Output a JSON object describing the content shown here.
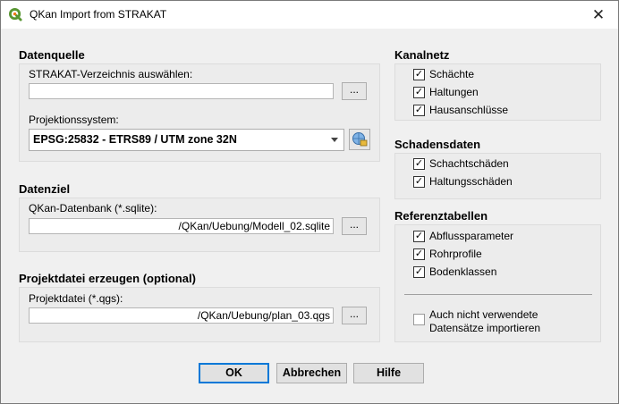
{
  "window": {
    "title": "QKan Import from STRAKAT",
    "close_glyph": "✕"
  },
  "datenquelle": {
    "heading": "Datenquelle",
    "dir_label": "STRAKAT-Verzeichnis auswählen:",
    "dir_value": "",
    "browse_label": "...",
    "proj_label": "Projektionssystem:",
    "proj_value": "EPSG:25832 - ETRS89 / UTM zone 32N"
  },
  "datenziel": {
    "heading": "Datenziel",
    "db_label": "QKan-Datenbank (*.sqlite):",
    "db_value": "/QKan/Uebung/Modell_02.sqlite",
    "browse_label": "..."
  },
  "projektdatei": {
    "heading": "Projektdatei erzeugen (optional)",
    "file_label": "Projektdatei (*.qgs):",
    "file_value": "/QKan/Uebung/plan_03.qgs",
    "browse_label": "..."
  },
  "kanalnetz": {
    "heading": "Kanalnetz",
    "items": [
      {
        "label": "Schächte",
        "checked": true
      },
      {
        "label": "Haltungen",
        "checked": true
      },
      {
        "label": "Hausanschlüsse",
        "checked": true
      }
    ]
  },
  "schadensdaten": {
    "heading": "Schadensdaten",
    "items": [
      {
        "label": "Schachtschäden",
        "checked": true
      },
      {
        "label": "Haltungsschäden",
        "checked": true
      }
    ]
  },
  "referenztabellen": {
    "heading": "Referenztabellen",
    "items": [
      {
        "label": "Abflussparameter",
        "checked": true
      },
      {
        "label": "Rohrprofile",
        "checked": true
      },
      {
        "label": "Bodenklassen",
        "checked": true
      }
    ],
    "unused_line1": "Auch nicht verwendete",
    "unused_line2": "Datensätze importieren",
    "unused_checked": false
  },
  "buttons": {
    "ok": "OK",
    "cancel": "Abbrechen",
    "help": "Hilfe"
  },
  "colors": {
    "accent": "#0078d7",
    "qgis_green": "#589632",
    "panel_bg": "#ececec"
  },
  "icons": {
    "app": "qgis-logo-icon",
    "close": "close-icon",
    "crs": "crs-selector-icon"
  }
}
